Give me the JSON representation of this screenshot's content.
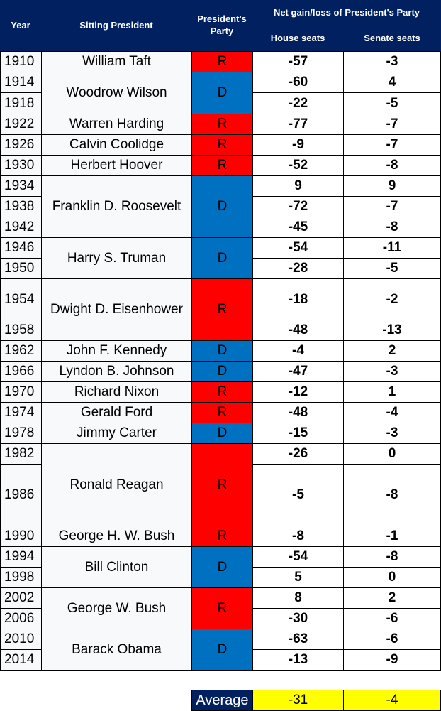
{
  "header": {
    "year": "Year",
    "president": "Sitting President",
    "party": "President's Party",
    "net_group": "Net gain/loss of President's Party",
    "house": "House seats",
    "senate": "Senate seats"
  },
  "colors": {
    "header_bg": "#002060",
    "republican": "#ff0000",
    "democrat": "#0070c0",
    "average_bg": "#ffff00"
  },
  "presidents": [
    {
      "name": "William Taft",
      "party": "R"
    },
    {
      "name": "Woodrow Wilson",
      "party": "D"
    },
    {
      "name": "Warren Harding",
      "party": "R"
    },
    {
      "name": "Calvin Coolidge",
      "party": "R"
    },
    {
      "name": "Herbert Hoover",
      "party": "R"
    },
    {
      "name": "Franklin D. Roosevelt",
      "party": "D"
    },
    {
      "name": "Harry S. Truman",
      "party": "D"
    },
    {
      "name": "Dwight D. Eisenhower",
      "party": "R"
    },
    {
      "name": "John F. Kennedy",
      "party": "D"
    },
    {
      "name": "Lyndon B. Johnson",
      "party": "D"
    },
    {
      "name": "Richard Nixon",
      "party": "R"
    },
    {
      "name": "Gerald Ford",
      "party": "R"
    },
    {
      "name": "Jimmy Carter",
      "party": "D"
    },
    {
      "name": "Ronald Reagan",
      "party": "R"
    },
    {
      "name": "George H. W. Bush",
      "party": "R"
    },
    {
      "name": "Bill Clinton",
      "party": "D"
    },
    {
      "name": "George W. Bush",
      "party": "R"
    },
    {
      "name": "Barack Obama",
      "party": "D"
    }
  ],
  "elections": [
    {
      "year": "1910",
      "house": "-57",
      "senate": "-3"
    },
    {
      "year": "1914",
      "house": "-60",
      "senate": "4"
    },
    {
      "year": "1918",
      "house": "-22",
      "senate": "-5"
    },
    {
      "year": "1922",
      "house": "-77",
      "senate": "-7"
    },
    {
      "year": "1926",
      "house": "-9",
      "senate": "-7"
    },
    {
      "year": "1930",
      "house": "-52",
      "senate": "-8"
    },
    {
      "year": "1934",
      "house": "9",
      "senate": "9"
    },
    {
      "year": "1938",
      "house": "-72",
      "senate": "-7"
    },
    {
      "year": "1942",
      "house": "-45",
      "senate": "-8"
    },
    {
      "year": "1946",
      "house": "-54",
      "senate": "-11"
    },
    {
      "year": "1950",
      "house": "-28",
      "senate": "-5"
    },
    {
      "year": "1954",
      "house": "-18",
      "senate": "-2"
    },
    {
      "year": "1958",
      "house": "-48",
      "senate": "-13"
    },
    {
      "year": "1962",
      "house": "-4",
      "senate": "2"
    },
    {
      "year": "1966",
      "house": "-47",
      "senate": "-3"
    },
    {
      "year": "1970",
      "house": "-12",
      "senate": "1"
    },
    {
      "year": "1974",
      "house": "-48",
      "senate": "-4"
    },
    {
      "year": "1978",
      "house": "-15",
      "senate": "-3"
    },
    {
      "year": "1982",
      "house": "-26",
      "senate": "0"
    },
    {
      "year": "1986",
      "house": "-5",
      "senate": "-8"
    },
    {
      "year": "1990",
      "house": "-8",
      "senate": "-1"
    },
    {
      "year": "1994",
      "house": "-54",
      "senate": "-8"
    },
    {
      "year": "1998",
      "house": "5",
      "senate": "0"
    },
    {
      "year": "2002",
      "house": "8",
      "senate": "2"
    },
    {
      "year": "2006",
      "house": "-30",
      "senate": "-6"
    },
    {
      "year": "2010",
      "house": "-63",
      "senate": "-6"
    },
    {
      "year": "2014",
      "house": "-13",
      "senate": "-9"
    }
  ],
  "average": {
    "label": "Average",
    "house": "-31",
    "senate": "-4"
  }
}
